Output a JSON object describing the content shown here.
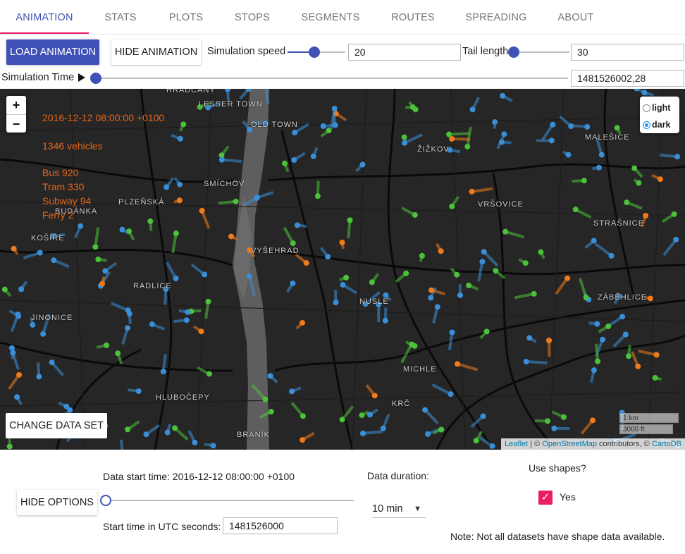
{
  "tabs": [
    {
      "label": "ANIMATION",
      "active": true
    },
    {
      "label": "STATS"
    },
    {
      "label": "PLOTS"
    },
    {
      "label": "STOPS"
    },
    {
      "label": "SEGMENTS"
    },
    {
      "label": "ROUTES"
    },
    {
      "label": "SPREADING"
    },
    {
      "label": "ABOUT"
    }
  ],
  "toolbar": {
    "load_label": "LOAD ANIMATION",
    "hide_animation_label": "HIDE ANIMATION",
    "speed_label": "Simulation speed",
    "speed_value": "20",
    "tail_label": "Tail length",
    "tail_value": "30",
    "sim_time_label": "Simulation Time",
    "play_icon": "play-icon",
    "sim_time_value": "1481526002,28",
    "sim_time_progress": 0.0
  },
  "map": {
    "overlay": {
      "timestamp": "2016-12-12 08:00:00 +0100",
      "vehicles": "1346 vehicles",
      "bus": "Bus 920",
      "tram": "Tram 330",
      "subway": "Subway 94",
      "ferry": "Ferry 2"
    },
    "zoom_in": "+",
    "zoom_out": "−",
    "layers": {
      "light": "light",
      "dark": "dark",
      "selected": "dark"
    },
    "places": {
      "hradcany": "HRADČANY",
      "lesser_town": "LESSER TOWN",
      "old_town": "OLD TOWN",
      "zizkov": "ŽIŽKOV",
      "malesice": "MALEŠICE",
      "smichov": "SMÍCHOV",
      "plzenska": "PLZEŇSKÁ",
      "budanka": "BUDÁNKA",
      "kosire": "KOŠÍŘE",
      "vrsovice": "VRŠOVICE",
      "strasnice": "STRAŠNICE",
      "vysehrad": "VYŠEHRAD",
      "radlice": "RADLICE",
      "zabehlice": "ZÁBĚHLICE",
      "nusle": "NUSLE",
      "jinonice": "JINONICE",
      "michle": "MICHLE",
      "krc": "KRČ",
      "hlubocepy": "HLUBOČEPY",
      "branik": "BRANÍK"
    },
    "scale_km": "1 km",
    "scale_ft": "3000 ft",
    "attribution": {
      "leaflet": "Leaflet",
      "sep1": " | © ",
      "osm": "OpenStreetMap",
      "contrib": " contributors, © ",
      "carto": "CartoDB"
    },
    "change_data_label": "CHANGE DATA SET",
    "colors": {
      "bus": "#3a8fd9",
      "tram": "#4cc23b",
      "subway": "#f07b1a",
      "water": "#6a6a6a",
      "roads": "#0c0c0c"
    }
  },
  "options": {
    "hide_options_label": "HIDE OPTIONS",
    "data_start_label": "Data start time: 2016-12-12 08:00:00 +0100",
    "utc_label": "Start time in UTC seconds:",
    "utc_value": "1481526000",
    "start_slider_progress": 0.0,
    "duration_label": "Data duration:",
    "duration_value": "10 min",
    "shapes_label": "Use shapes?",
    "shapes_checked": true,
    "shapes_yes": "Yes",
    "note": "Note: Not all datasets have shape data available."
  }
}
